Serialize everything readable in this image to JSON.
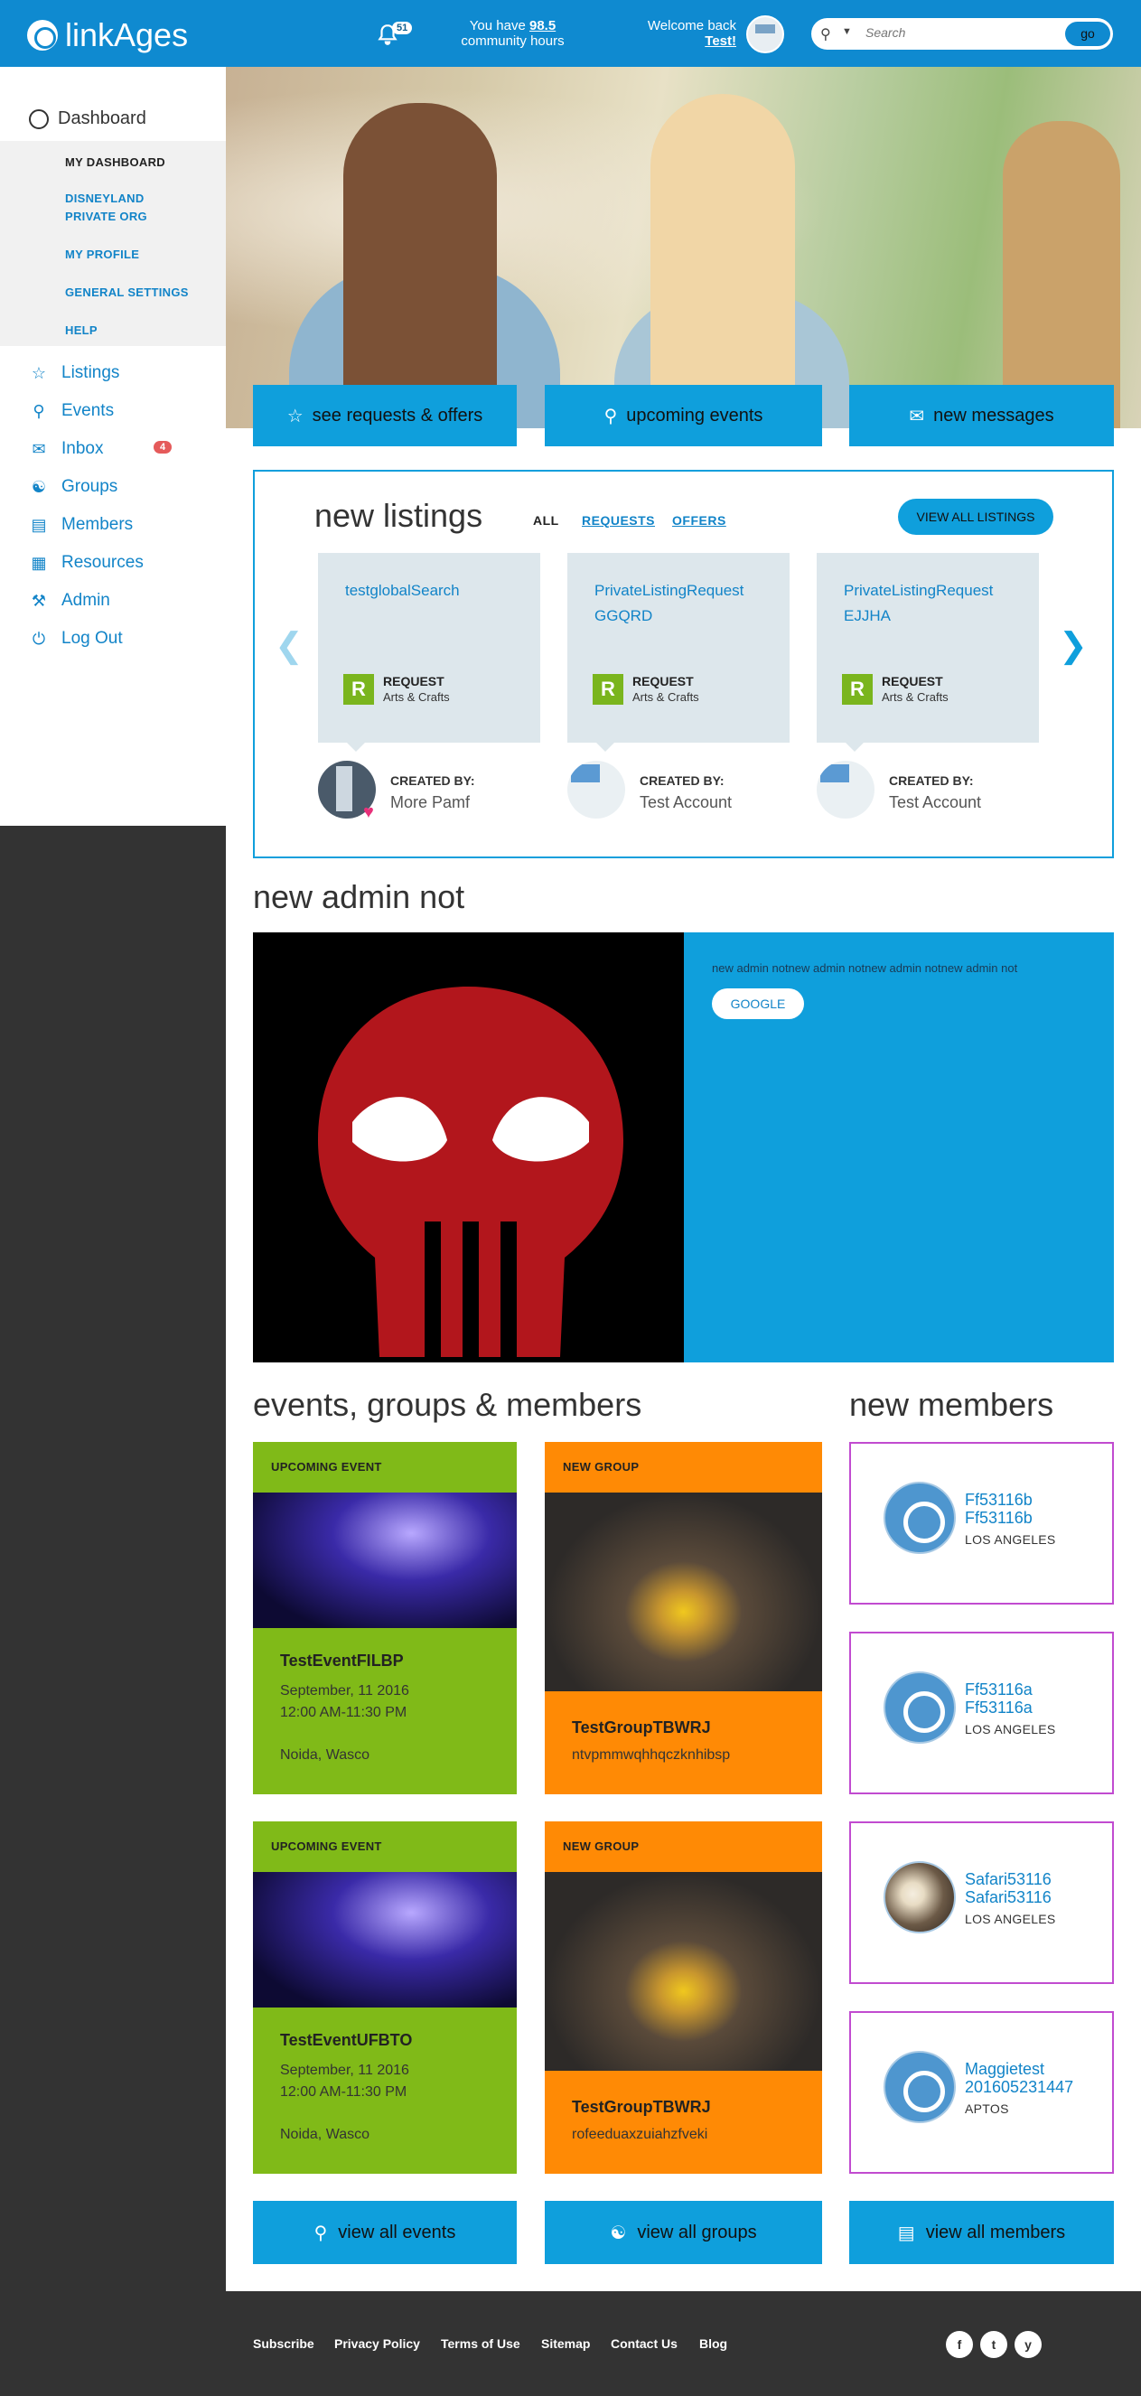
{
  "header": {
    "logo_text": "linkAges",
    "notification_count": "51",
    "hours_prefix": "You have",
    "hours_value": "98.5",
    "hours_suffix": "community hours",
    "welcome_text": "Welcome back",
    "user_name": "Test!",
    "search_placeholder": "Search",
    "search_button": "go"
  },
  "sidebar": {
    "dashboard_label": "Dashboard",
    "subnav": [
      "MY DASHBOARD",
      "DISNEYLAND",
      "PRIVATE ORG",
      "MY PROFILE",
      "GENERAL SETTINGS",
      "HELP"
    ],
    "items": [
      {
        "label": "Listings",
        "icon": "star-icon"
      },
      {
        "label": "Events",
        "icon": "pin-icon"
      },
      {
        "label": "Inbox",
        "icon": "envelope-icon",
        "badge": "4"
      },
      {
        "label": "Groups",
        "icon": "groups-icon"
      },
      {
        "label": "Members",
        "icon": "members-icon"
      },
      {
        "label": "Resources",
        "icon": "book-icon"
      },
      {
        "label": "Admin",
        "icon": "wrench-icon"
      },
      {
        "label": "Log Out",
        "icon": "power-icon"
      }
    ]
  },
  "hero": {
    "cta": [
      "see requests & offers",
      "upcoming events",
      "new messages"
    ]
  },
  "listings": {
    "title": "new listings",
    "filters": [
      "ALL",
      "REQUESTS",
      "OFFERS"
    ],
    "view_all": "VIEW ALL LISTINGS",
    "cards": [
      {
        "title": "testglobalSearch",
        "badge": "R",
        "type": "REQUEST",
        "category": "Arts & Crafts",
        "created_by_label": "CREATED BY:",
        "creator": "More Pamf"
      },
      {
        "title": "PrivateListingRequest GGQRD",
        "badge": "R",
        "type": "REQUEST",
        "category": "Arts & Crafts",
        "created_by_label": "CREATED BY:",
        "creator": "Test Account"
      },
      {
        "title": "PrivateListingRequest EJJHA",
        "badge": "R",
        "type": "REQUEST",
        "category": "Arts & Crafts",
        "created_by_label": "CREATED BY:",
        "creator": "Test Account"
      }
    ]
  },
  "admin": {
    "title": "new admin not",
    "text": "new admin notnew admin notnew admin notnew admin not",
    "button": "GOOGLE"
  },
  "egm": {
    "title": "events, groups & members",
    "members_title": "new members",
    "events": [
      {
        "label": "UPCOMING EVENT",
        "name": "TestEventFILBP",
        "date": "September, 11 2016",
        "time": "12:00 AM-11:30 PM",
        "location": "Noida, Wasco"
      },
      {
        "label": "UPCOMING EVENT",
        "name": "TestEventUFBTO",
        "date": "September, 11 2016",
        "time": "12:00 AM-11:30 PM",
        "location": "Noida, Wasco"
      }
    ],
    "groups": [
      {
        "label": "NEW GROUP",
        "name": "TestGroupTBWRJ",
        "desc": "ntvpmmwqhhqczknhibsp"
      },
      {
        "label": "NEW GROUP",
        "name": "TestGroupTBWRJ",
        "desc": "rofeeduaxzuiahzfveki"
      }
    ],
    "members": [
      {
        "name1": "Ff53116b",
        "name2": "Ff53116b",
        "location": "LOS ANGELES"
      },
      {
        "name1": "Ff53116a",
        "name2": "Ff53116a",
        "location": "LOS ANGELES"
      },
      {
        "name1": "Safari53116",
        "name2": "Safari53116",
        "location": "LOS ANGELES"
      },
      {
        "name1": "Maggietest",
        "name2": "201605231447",
        "location": "APTOS"
      }
    ],
    "view_buttons": [
      "view all events",
      "view all groups",
      "view all members"
    ]
  },
  "footer": {
    "links": [
      "Subscribe",
      "Privacy Policy",
      "Terms of Use",
      "Sitemap",
      "Contact Us",
      "Blog"
    ],
    "social": [
      "f",
      "t",
      "y"
    ]
  }
}
